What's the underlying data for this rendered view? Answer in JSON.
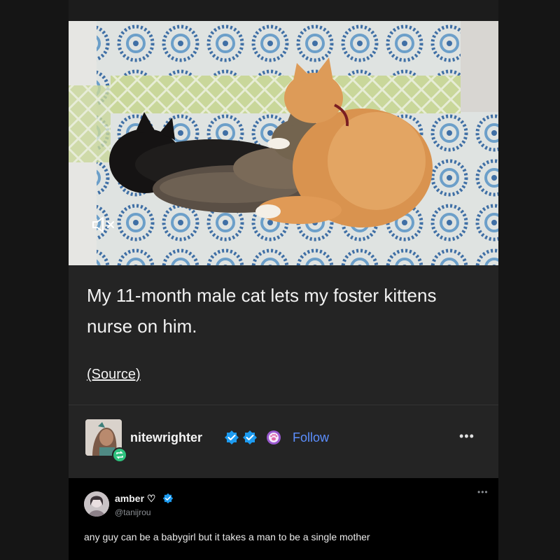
{
  "post": {
    "caption": "My 11-month male cat lets my foster kittens nurse on him.",
    "source_label": "(Source)",
    "media": {
      "mute_icon": "volume-muted-icon"
    }
  },
  "author": {
    "username": "nitewrighter",
    "follow_label": "Follow",
    "more_label": "•••",
    "badges": [
      "verified-badge-icon",
      "verified-badge-icon",
      "paw-badge-icon"
    ],
    "reblog_icon": "reblog-icon"
  },
  "tweet": {
    "display_name": "amber ♡",
    "handle": "@tanijrou",
    "text": "any guy can be a babygirl but it takes a man to be a single mother",
    "more_label": "•••"
  },
  "colors": {
    "background": "#151515",
    "card": "#242424",
    "link_blue": "#5c8fff",
    "verified_blue": "#1d9bf0"
  }
}
